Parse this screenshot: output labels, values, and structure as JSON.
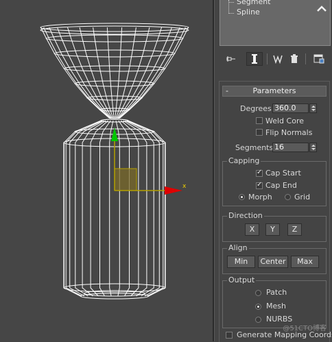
{
  "modifier_stack": {
    "items": [
      "Segment",
      "Spline"
    ]
  },
  "toolbar": {
    "icons": [
      "pin-stack-icon",
      "show-end-result-icon",
      "make-unique-icon",
      "remove-modifier-icon",
      "configure-modifier-sets-icon"
    ]
  },
  "viewport": {
    "gizmo_axis_x": "x",
    "wire_color": "#ffffff",
    "y_axis_color": "#00c800",
    "x_axis_color": "#e00000",
    "pivot_color": "#b4a000"
  },
  "parameters": {
    "title": "Parameters",
    "collapse_symbol": "-",
    "degrees_label": "Degrees:",
    "degrees_value": "360.0",
    "weld_core_label": "Weld Core",
    "weld_core_checked": false,
    "flip_normals_label": "Flip Normals",
    "flip_normals_checked": false,
    "segments_label": "Segments:",
    "segments_value": "16",
    "capping": {
      "title": "Capping",
      "cap_start_label": "Cap Start",
      "cap_start_checked": true,
      "cap_end_label": "Cap End",
      "cap_end_checked": true,
      "morph_label": "Morph",
      "grid_label": "Grid",
      "selected": "Morph"
    },
    "direction": {
      "title": "Direction",
      "x_label": "X",
      "y_label": "Y",
      "z_label": "Z"
    },
    "align": {
      "title": "Align",
      "min_label": "Min",
      "center_label": "Center",
      "max_label": "Max"
    },
    "output": {
      "title": "Output",
      "patch_label": "Patch",
      "mesh_label": "Mesh",
      "nurbs_label": "NURBS",
      "selected": "Mesh"
    },
    "generate_mapping_label": "Generate Mapping Coords.",
    "generate_mapping_checked": false
  },
  "watermark": "@51CTO博客"
}
